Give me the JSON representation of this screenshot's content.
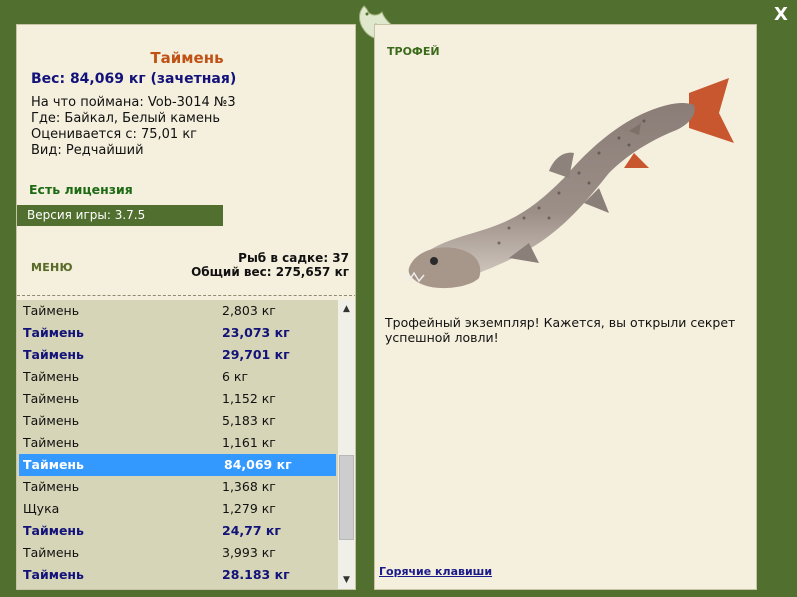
{
  "window": {
    "close_label": "X"
  },
  "fish": {
    "name": "Таймень",
    "weight_line": "Вес: 84,069 кг (зачетная)",
    "caught_on": "На что поймана: Vob-3014 №3",
    "where": "Где: Байкал, Белый камень",
    "price": "Оценивается с: 75,01 кг",
    "kind": "Вид: Редчайший"
  },
  "license": "Есть лицензия",
  "version": "Версия игры: 3.7.5",
  "menu_label": "МЕНЮ",
  "stats": {
    "fish_count": "Рыб в садке: 37",
    "total_weight": "Общий вес: 275,657 кг"
  },
  "catch_list": [
    {
      "name": "Таймень",
      "weight": "2,803 кг",
      "style": ""
    },
    {
      "name": "Таймень",
      "weight": "23,073 кг",
      "style": "bold"
    },
    {
      "name": "Таймень",
      "weight": "29,701 кг",
      "style": "bold"
    },
    {
      "name": "Таймень",
      "weight": "6 кг",
      "style": ""
    },
    {
      "name": "Таймень",
      "weight": "1,152 кг",
      "style": ""
    },
    {
      "name": "Таймень",
      "weight": "5,183 кг",
      "style": ""
    },
    {
      "name": "Таймень",
      "weight": "1,161 кг",
      "style": ""
    },
    {
      "name": "Таймень",
      "weight": "84,069 кг",
      "style": "selected"
    },
    {
      "name": "Таймень",
      "weight": "1,368 кг",
      "style": ""
    },
    {
      "name": "Щука",
      "weight": "1,279 кг",
      "style": ""
    },
    {
      "name": "Таймень",
      "weight": "24,77 кг",
      "style": "bold"
    },
    {
      "name": "Таймень",
      "weight": "3,993 кг",
      "style": ""
    },
    {
      "name": "Таймень",
      "weight": "28.183 кг",
      "style": "bold"
    }
  ],
  "trophy": {
    "title": "ТРОФЕЙ",
    "text": "Трофейный экземпляр! Кажется, вы открыли секрет успешной ловли!",
    "hotkeys": "Горячие клавиши"
  },
  "icons": {
    "logo": "fish-logo-icon",
    "fish_picture": "taimen-fish-image",
    "scroll_up": "scroll-up-icon",
    "scroll_down": "scroll-down-icon"
  },
  "colors": {
    "frame": "#517030",
    "panel": "#f5f0dd",
    "list_bg": "#d6d5b7",
    "selection": "#3399ff",
    "name_color": "#c05216",
    "weight_color": "#12127a"
  }
}
